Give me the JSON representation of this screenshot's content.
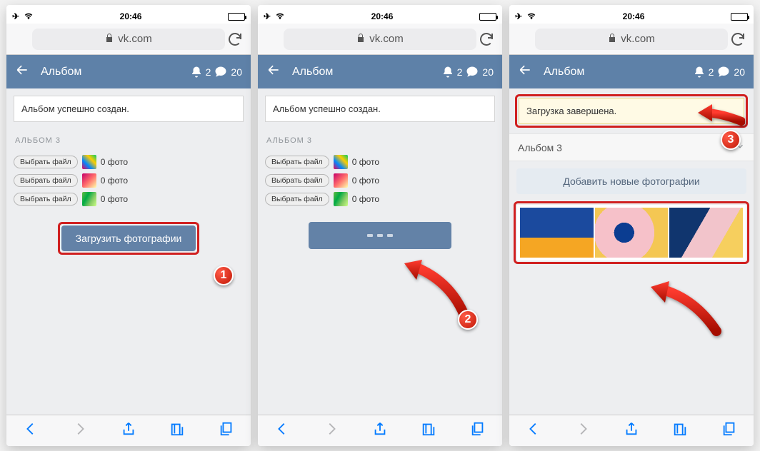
{
  "status": {
    "time": "20:46"
  },
  "addr": {
    "domain": "vk.com"
  },
  "header": {
    "title": "Альбом",
    "notif_count": "2",
    "msg_count": "20"
  },
  "screen1": {
    "notice": "Альбом успешно создан.",
    "album_label": "АЛЬБОМ 3",
    "file_btn": "Выбрать файл",
    "file_count": "0 фото",
    "upload_btn": "Загрузить фотографии"
  },
  "screen2": {
    "notice": "Альбом успешно создан.",
    "album_label": "АЛЬБОМ 3",
    "file_btn": "Выбрать файл",
    "file_count": "0 фото"
  },
  "screen3": {
    "notice": "Загрузка завершена.",
    "album_row": "Альбом 3",
    "add_btn": "Добавить новые фотографии"
  },
  "steps": {
    "s1": "1",
    "s2": "2",
    "s3": "3"
  }
}
